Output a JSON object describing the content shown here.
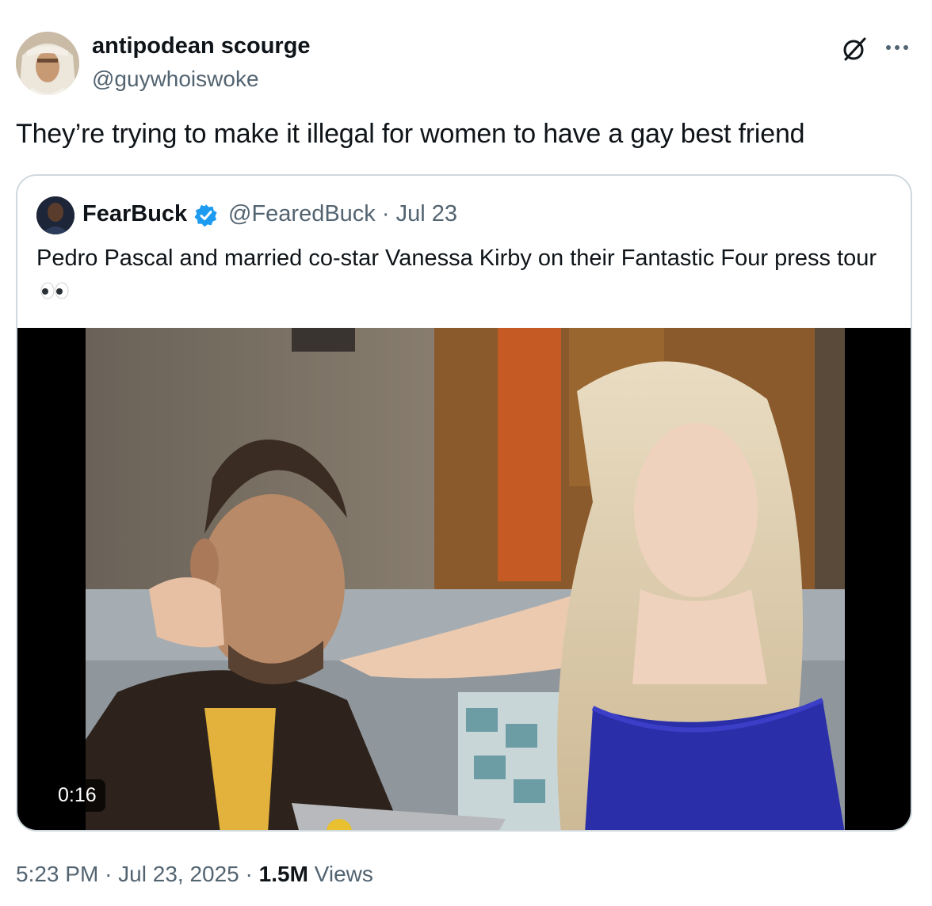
{
  "author": {
    "display_name": "antipodean scourge",
    "handle": "@guywhoiswoke"
  },
  "tweet": {
    "text": "They’re trying to make it illegal for women to have a gay best friend"
  },
  "quoted_tweet": {
    "display_name": "FearBuck",
    "verified": true,
    "handle": "@FearedBuck",
    "separator": "·",
    "date": "Jul 23",
    "text": "Pedro Pascal and married co-star Vanessa Kirby on their Fantastic Four press tour",
    "emoji": "👀",
    "video_duration": "0:16"
  },
  "footer": {
    "time": "5:23 PM",
    "separator": "·",
    "date": "Jul 23, 2025",
    "views_count": "1.5M",
    "views_label": "Views"
  },
  "colors": {
    "text_primary": "#0f1419",
    "text_secondary": "#536471",
    "border": "#cfd9de",
    "verified_blue": "#1d9bf0"
  },
  "icons": {
    "grok": "grok-icon",
    "more": "more-icon",
    "verified": "verified-icon"
  }
}
